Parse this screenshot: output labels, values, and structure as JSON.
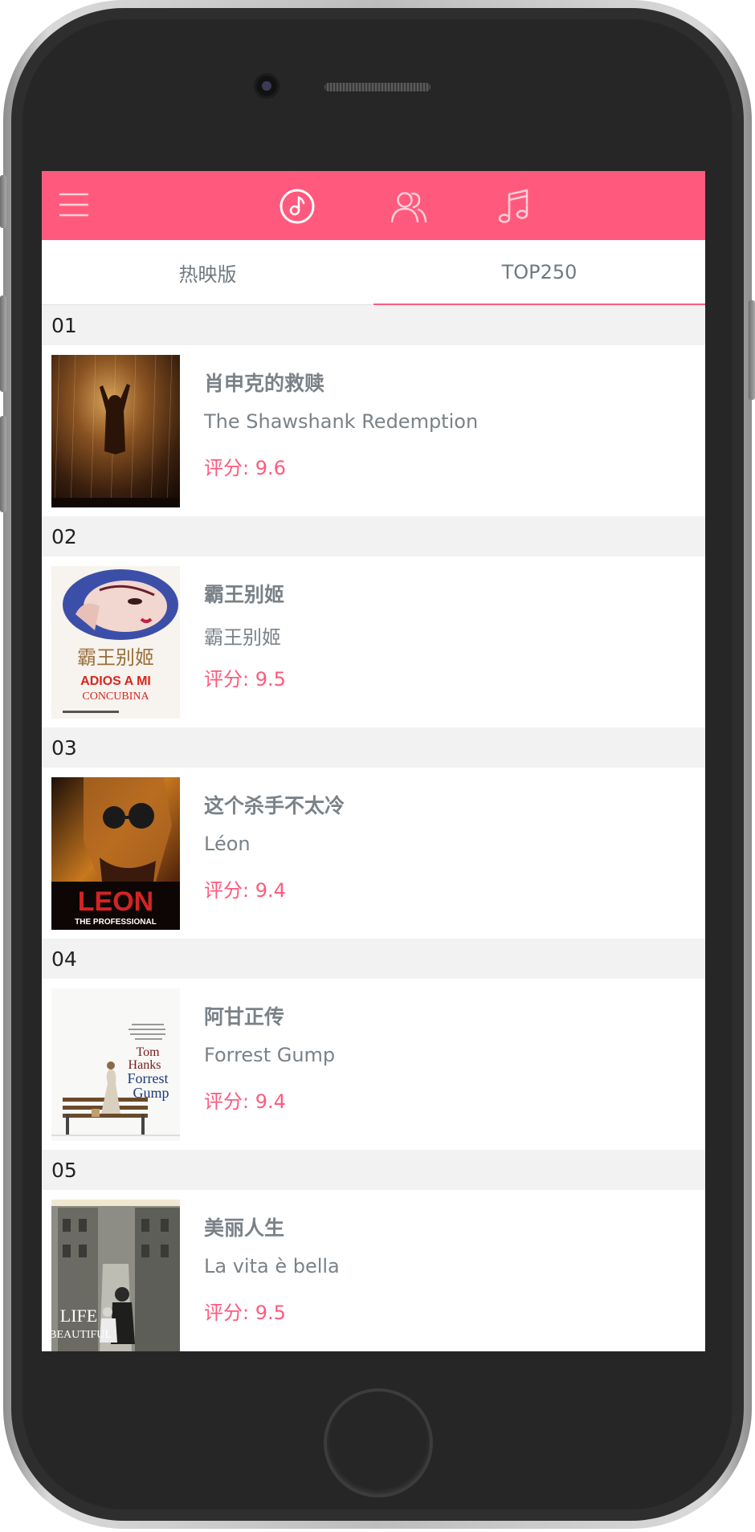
{
  "header": {
    "menu_icon": "menu-icon",
    "nav": [
      {
        "icon": "music-disc-icon"
      },
      {
        "icon": "users-icon"
      },
      {
        "icon": "music-note-icon"
      }
    ]
  },
  "tabs": [
    {
      "label": "热映版"
    },
    {
      "label": "TOP250"
    }
  ],
  "active_tab": "TOP250",
  "movies": [
    {
      "rank": "01",
      "title": "肖申克的救赎",
      "original_title": "The Shawshank Redemption",
      "rating": "评分: 9.6"
    },
    {
      "rank": "02",
      "title": "霸王别姬",
      "original_title": "霸王别姬",
      "rating": "评分: 9.5"
    },
    {
      "rank": "03",
      "title": "这个杀手不太冷",
      "original_title": "Léon",
      "rating": "评分: 9.4"
    },
    {
      "rank": "04",
      "title": "阿甘正传",
      "original_title": "Forrest Gump",
      "rating": "评分: 9.4"
    },
    {
      "rank": "05",
      "title": "美丽人生",
      "original_title": "La vita è bella",
      "rating": "评分: 9.5"
    }
  ],
  "posters": {
    "p2": {
      "title_cn": "霸王别姬",
      "line1": "ADIOS A MI",
      "line2": "CONCUBINA"
    },
    "p3": {
      "line1": "LEON",
      "line2": "THE PROFESSIONAL"
    },
    "p4": {
      "line1": "Tom",
      "line2": "Hanks",
      "line3": "Forrest",
      "line4": "Gump"
    },
    "p5": {
      "line1": "LIFE",
      "line2": "BEAUTIFUL"
    }
  },
  "colors": {
    "accent": "#ff5a7d",
    "section_bg": "#f2f2f2",
    "text_muted": "#7a8288"
  }
}
